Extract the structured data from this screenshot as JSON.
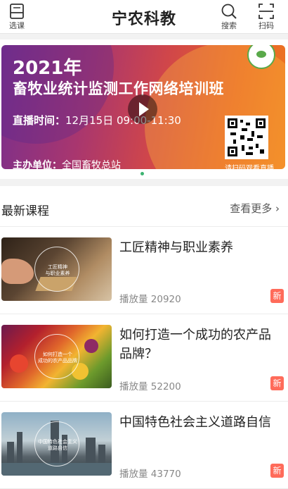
{
  "header": {
    "title": "宁农科教",
    "left_button_label": "选课",
    "search_label": "搜索",
    "scan_label": "扫码"
  },
  "banner": {
    "year": "2021年",
    "name": "畜牧业统计监测工作网络培训班",
    "time_label": "直播时间：",
    "time_value": "12月15日  09:00-11:30",
    "host_label": "主办单位：",
    "host_value": "全国畜牧总站",
    "qr_caption": "请扫码观看直播"
  },
  "latest": {
    "title": "最新课程",
    "more_label": "查看更多 ›",
    "views_prefix": "播放量",
    "items": [
      {
        "title": "工匠精神与职业素养",
        "views": "播放量 20920",
        "badge": "新",
        "thumb_caption": "工匠精神\n与职业素养"
      },
      {
        "title": "如何打造一个成功的农产品品牌？",
        "views": "播放量 52200",
        "badge": "新",
        "thumb_caption": "如何打造一个\n成功的农产品品牌"
      },
      {
        "title": "中国特色社会主义道路自信",
        "views": "播放量 43770",
        "badge": "新",
        "thumb_caption": "中国特色社会主义\n道路自信"
      }
    ]
  },
  "colors": {
    "accent_green": "#3cb371",
    "badge_red": "#ff6b5a"
  },
  "icons": {
    "course": "book-icon",
    "search": "search-icon",
    "scan": "scan-icon",
    "play": "play-icon"
  }
}
